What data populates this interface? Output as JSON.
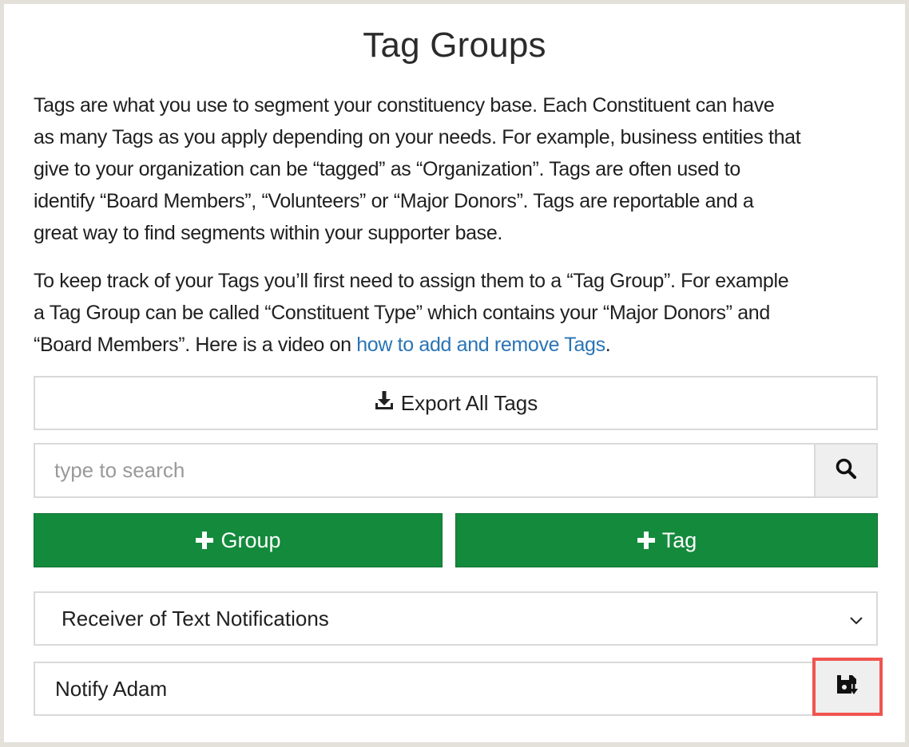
{
  "page": {
    "title": "Tag Groups",
    "description_1": "Tags are what you use to segment your constituency base. Each Constituent can have\nas many Tags as you apply depending on your needs. For example, business entities that\ngive to your organization can be “tagged” as “Organization”. Tags are often used to\nidentify “Board Members”, “Volunteers” or “Major Donors”. Tags are reportable and a\ngreat way to find segments within your supporter base.",
    "description_2_before_link": "To keep track of your Tags you’ll first need to assign them to a “Tag Group”. For example\na Tag Group can be called “Constituent Type” which contains your “Major Donors” and\n“Board Members”. Here is a video on ",
    "description_2_link": "how to add and remove Tags",
    "description_2_after_link": "."
  },
  "toolbar": {
    "export_label": "Export All Tags",
    "export_icon": "download-icon"
  },
  "search": {
    "placeholder": "type to search",
    "value": "",
    "icon": "search-icon"
  },
  "actions": {
    "add_group_label": "Group",
    "add_tag_label": "Tag",
    "button_color": "#148a3c"
  },
  "tag_group_select": {
    "selected": "Receiver of Text Notifications",
    "icon": "chevron-down-icon"
  },
  "tag_row": {
    "name": "Notify Adam",
    "save_icon": "save-icon",
    "highlight_color": "#f0544f"
  }
}
